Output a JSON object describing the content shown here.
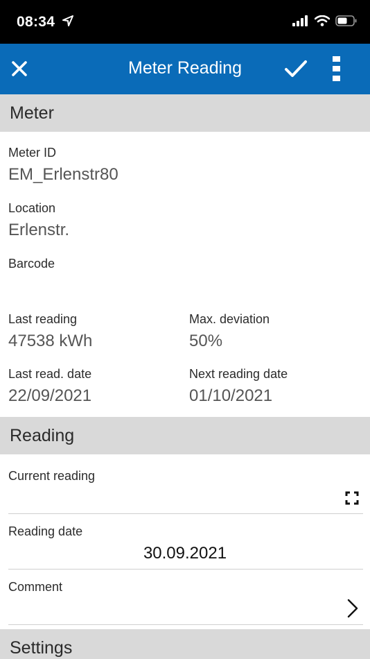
{
  "status_bar": {
    "time": "08:34"
  },
  "app_bar": {
    "title": "Meter Reading",
    "close_icon": "close-icon",
    "confirm_icon": "check-icon",
    "more_icon": "more-vertical-icon"
  },
  "meter_section": {
    "header": "Meter",
    "meter_id_label": "Meter ID",
    "meter_id_value": "EM_Erlenstr80",
    "location_label": "Location",
    "location_value": "Erlenstr.",
    "barcode_label": "Barcode",
    "barcode_value": "",
    "last_reading_label": "Last reading",
    "last_reading_value": "47538 kWh",
    "max_deviation_label": "Max. deviation",
    "max_deviation_value": "50%",
    "last_read_date_label": "Last read. date",
    "last_read_date_value": "22/09/2021",
    "next_reading_date_label": "Next reading date",
    "next_reading_date_value": "01/10/2021"
  },
  "reading_section": {
    "header": "Reading",
    "current_reading_label": "Current reading",
    "current_reading_value": "",
    "reading_date_label": "Reading date",
    "reading_date_value": "30.09.2021",
    "comment_label": "Comment",
    "comment_value": ""
  },
  "settings_section": {
    "header": "Settings"
  },
  "colors": {
    "app_bar": "#0a6bb8",
    "section_header": "#d9d9d9",
    "status_bar": "#000000"
  }
}
